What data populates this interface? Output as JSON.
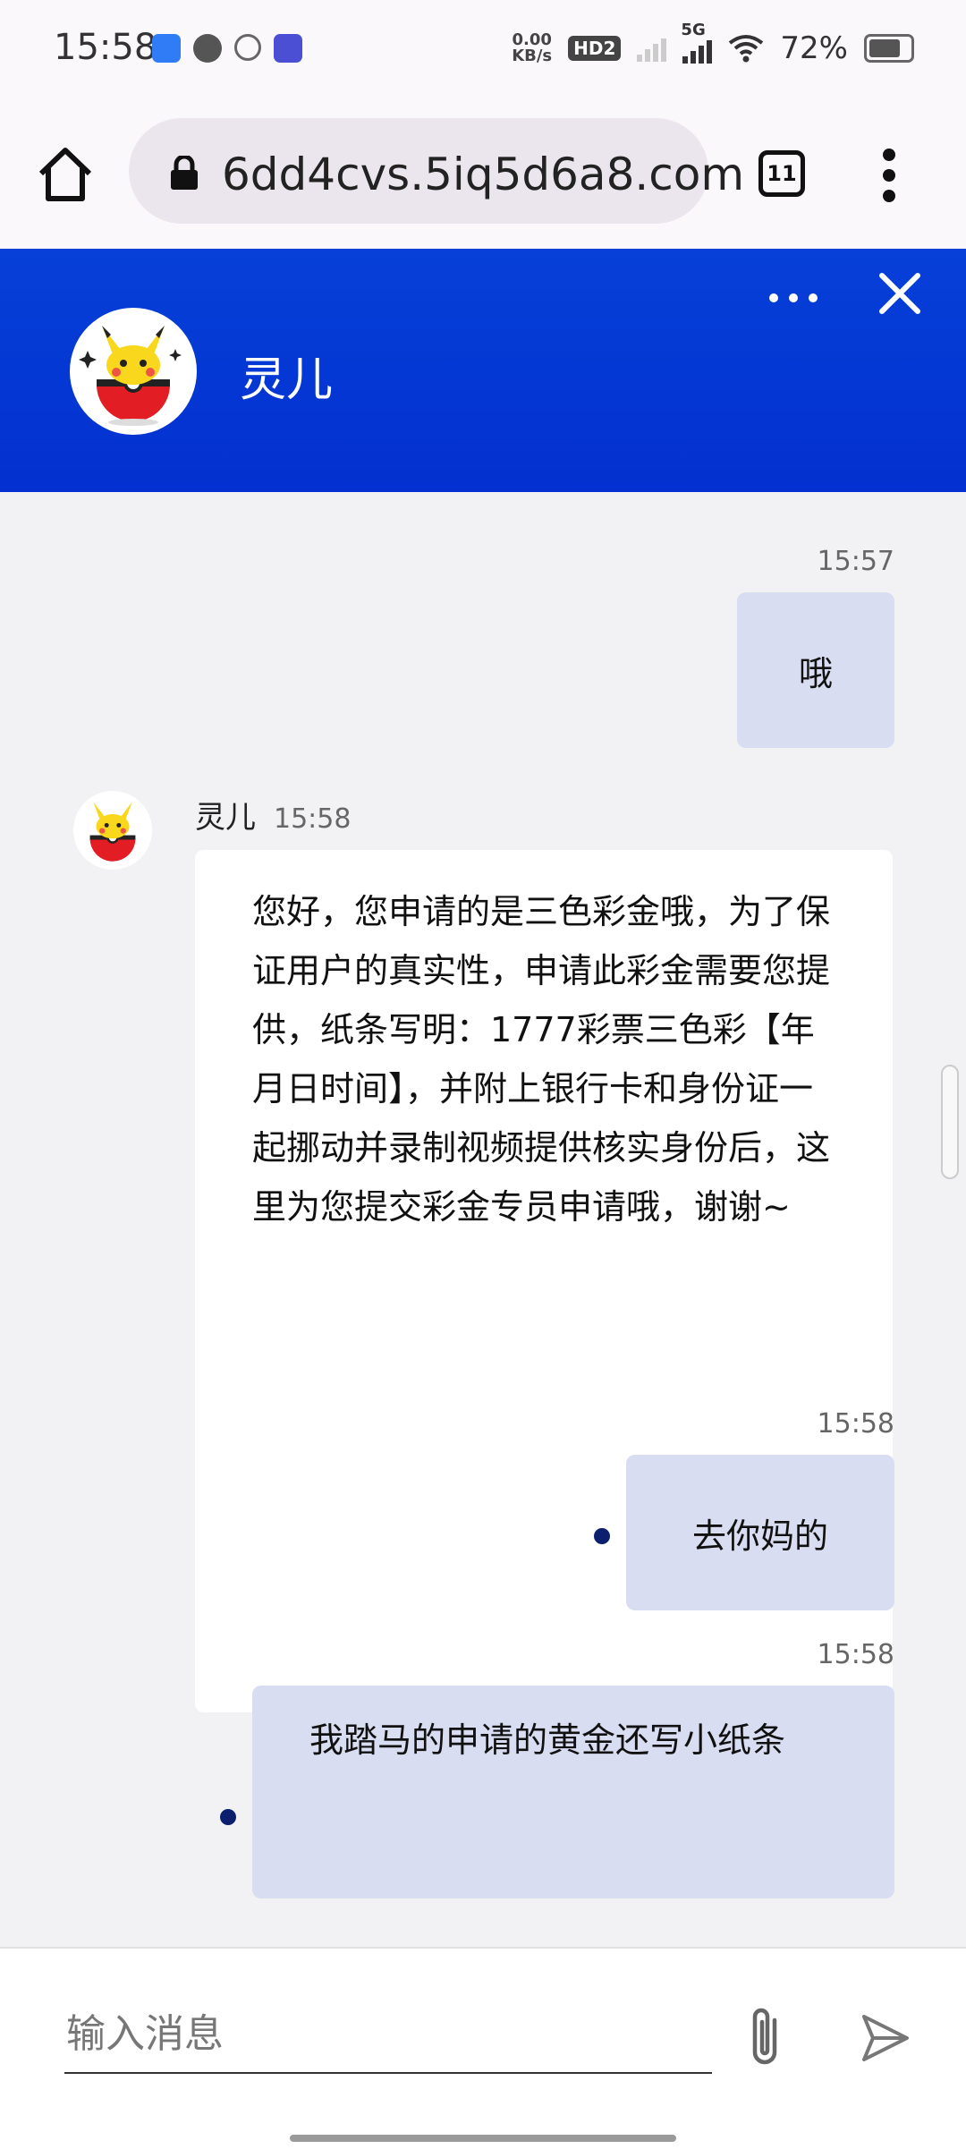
{
  "status_bar": {
    "time": "15:58",
    "net_speed": "0.00",
    "net_unit": "KB/s",
    "hd": "HD2",
    "network": "5G",
    "battery": "72%"
  },
  "browser": {
    "url": "6dd4cvs.5iq5d6a8.com",
    "tab_count": "11"
  },
  "chat_header": {
    "name": "灵儿"
  },
  "messages": [
    {
      "direction": "out",
      "time": "15:57",
      "text": "哦"
    },
    {
      "direction": "in",
      "sender": "灵儿",
      "time": "15:58",
      "text": "您好，您申请的是三色彩金哦，为了保证用户的真实性，申请此彩金需要您提供，纸条写明：1777彩票三色彩【年月日时间】，并附上银行卡和身份证一起挪动并录制视频提供核实身份后，这里为您提交彩金专员申请哦，谢谢~"
    },
    {
      "direction": "out",
      "time": "15:58",
      "text": "去你妈的"
    },
    {
      "direction": "out",
      "time": "15:58",
      "text": "我踏马的申请的黄金还写小纸条"
    }
  ],
  "composer": {
    "placeholder": "输入消息"
  },
  "colors": {
    "header_blue": "#0436d4",
    "outgoing_bubble": "#d9ddf2",
    "unread_dot": "#0b1f6e"
  }
}
